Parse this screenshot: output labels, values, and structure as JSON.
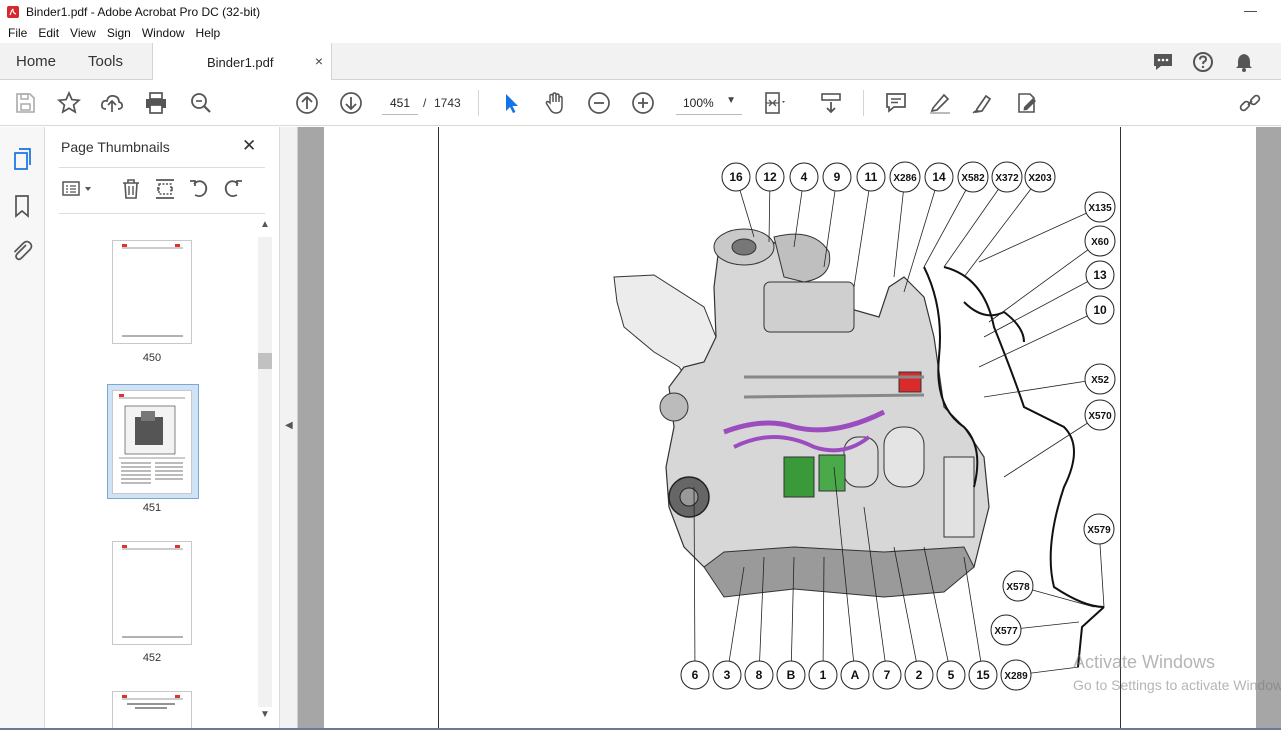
{
  "window": {
    "title": "Binder1.pdf - Adobe Acrobat Pro DC (32-bit)",
    "minimize": "—"
  },
  "menu": {
    "items": [
      "File",
      "Edit",
      "View",
      "Sign",
      "Window",
      "Help"
    ]
  },
  "tabs": {
    "home": "Home",
    "tools": "Tools",
    "document": "Binder1.pdf",
    "close": "×"
  },
  "toolbar": {
    "page_current": "451",
    "page_sep": "/",
    "page_total": "1743",
    "zoom": "100%"
  },
  "thumbnails": {
    "title": "Page Thumbnails",
    "close": "✕",
    "pages": [
      "450",
      "451",
      "452"
    ],
    "selected": "451"
  },
  "diagram": {
    "top_callouts": [
      "16",
      "12",
      "4",
      "9",
      "11",
      "X286",
      "14",
      "X582",
      "X372",
      "X203"
    ],
    "right_callouts": [
      "X135",
      "X60",
      "13",
      "10",
      "X52",
      "X570",
      "X579",
      "X578",
      "X577"
    ],
    "bottom_callouts": [
      "6",
      "3",
      "8",
      "B",
      "1",
      "A",
      "7",
      "2",
      "5",
      "15",
      "X289"
    ]
  },
  "watermark": {
    "line1": "Activate Windows",
    "line2": "Go to Settings to activate Windows."
  },
  "colors": {
    "accent": "#1473e6",
    "harness": "#111111",
    "purple": "#9b4dbf",
    "green": "#3a9a3a"
  }
}
